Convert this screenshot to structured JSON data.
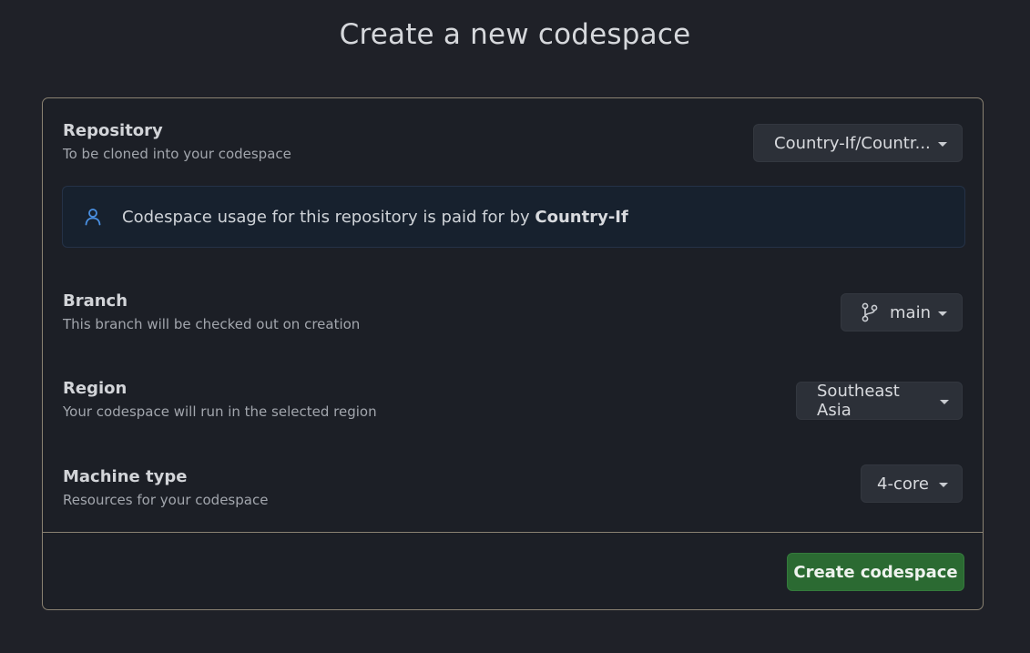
{
  "page": {
    "title": "Create a new codespace"
  },
  "repository": {
    "title": "Repository",
    "description": "To be cloned into your codespace",
    "selected": "Country-If/Countr..."
  },
  "notice": {
    "icon": "person-icon",
    "text_prefix": "Codespace usage for this repository is paid for by ",
    "owner": "Country-If"
  },
  "branch": {
    "title": "Branch",
    "description": "This branch will be checked out on creation",
    "icon": "git-branch-icon",
    "selected": "main"
  },
  "region": {
    "title": "Region",
    "description": "Your codespace will run in the selected region",
    "selected": "Southeast Asia"
  },
  "machine": {
    "title": "Machine type",
    "description": "Resources for your codespace",
    "selected": "4-core"
  },
  "actions": {
    "create_label": "Create codespace"
  },
  "colors": {
    "background": "#1f2128",
    "primary_button": "#2b6a32",
    "notice_background": "#17212e",
    "accent_icon": "#4a90e2"
  }
}
